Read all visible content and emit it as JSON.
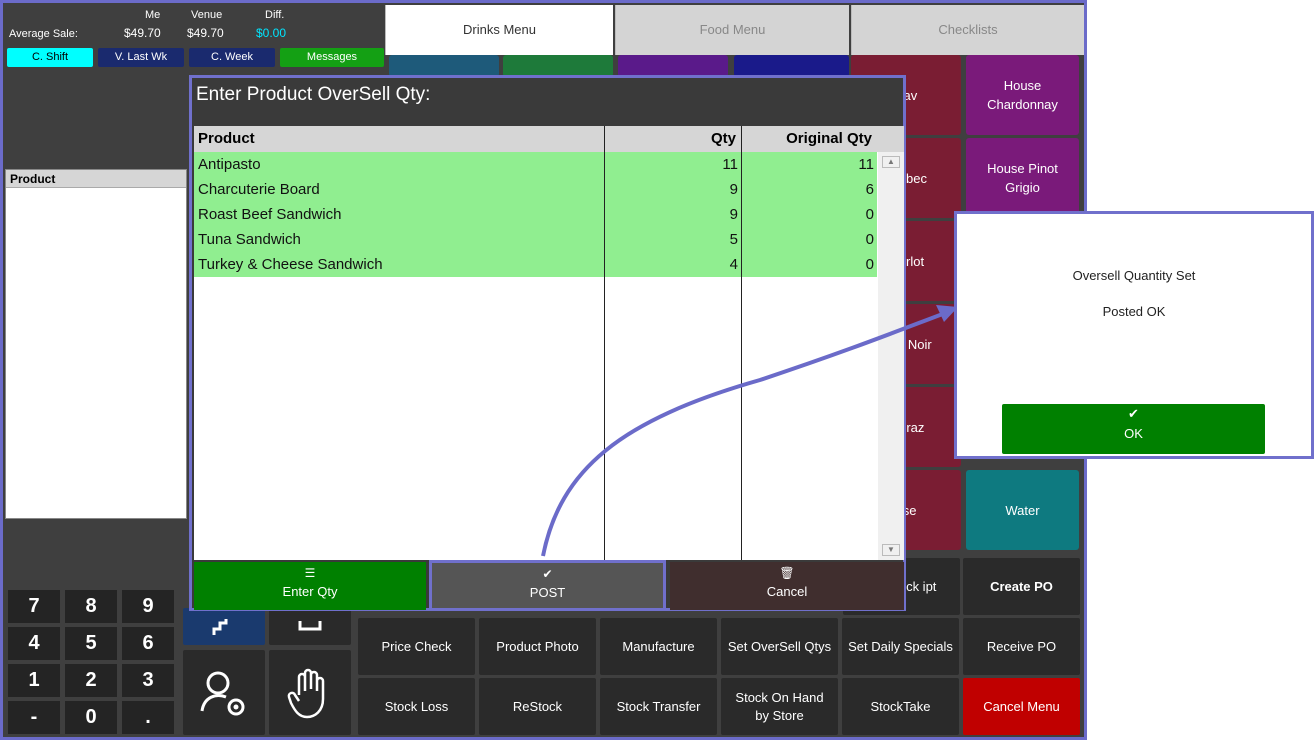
{
  "stats": {
    "average_sale_label": "Average Sale:",
    "me_label": "Me",
    "venue_label": "Venue",
    "diff_label": "Diff.",
    "me_value": "$49.70",
    "venue_value": "$49.70",
    "diff_value": "$0.00"
  },
  "period_buttons": [
    "C. Shift",
    "V. Last Wk",
    "C. Week",
    "Messages"
  ],
  "tabs": [
    "Drinks Menu",
    "Food Menu",
    "Checklists"
  ],
  "left_panel": {
    "header": "Product"
  },
  "menu_tiles": [
    "Sav",
    "House Chardonnay",
    "Malbec",
    "House Pinot Grigio",
    "Merlot",
    "not Noir",
    "Shiraz",
    "ose",
    "Water"
  ],
  "action_buttons": {
    "row1": [
      "Stock ipt",
      "Create PO"
    ],
    "row2": [
      "Price Check",
      "Product Photo",
      "Manufacture",
      "Set OverSell Qtys",
      "Set Daily Specials",
      "Receive PO"
    ],
    "row3": [
      "Stock Loss",
      "ReStock",
      "Stock Transfer",
      "Stock On Hand by Store",
      "StockTake",
      "Cancel Menu"
    ]
  },
  "keypad": [
    "7",
    "8",
    "9",
    "4",
    "5",
    "6",
    "1",
    "2",
    "3",
    "-",
    "0",
    "."
  ],
  "dialog": {
    "title": "Enter Product OverSell Qty:",
    "columns": [
      "Product",
      "Qty",
      "Original Qty"
    ],
    "rows": [
      [
        "Antipasto",
        "11",
        "11"
      ],
      [
        "Charcuterie Board",
        "9",
        "6"
      ],
      [
        "Roast Beef Sandwich",
        "9",
        "0"
      ],
      [
        "Tuna Sandwich",
        "5",
        "0"
      ],
      [
        "Turkey & Cheese Sandwich",
        "4",
        "0"
      ]
    ],
    "buttons": {
      "enter_qty": "Enter Qty",
      "post": "POST",
      "cancel": "Cancel"
    }
  },
  "popup": {
    "message1": "Oversell Quantity Set",
    "message2": "Posted OK",
    "ok_label": "OK"
  },
  "colors": {
    "accent_green": "#008000",
    "row_green": "#90ee90",
    "wine_red": "#7a1d33",
    "purple": "#7a1a7a",
    "teal": "#0e7a80",
    "cancel_red": "#c00000",
    "cyan": "#00ffff",
    "callout": "#6b6bc9"
  }
}
